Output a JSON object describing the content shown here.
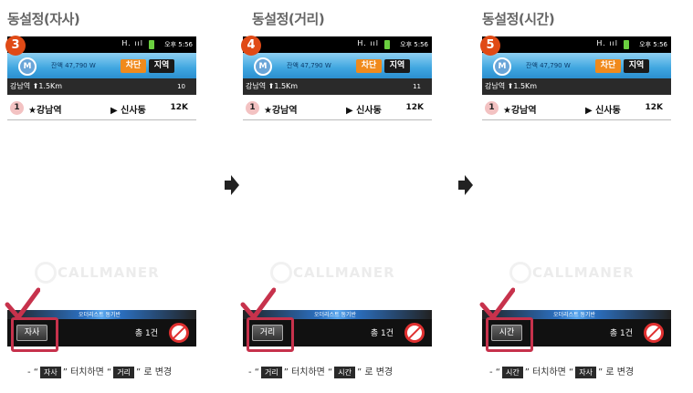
{
  "panels": [
    {
      "title": "동설정(자사)",
      "step": "3",
      "status": {
        "signal": "H. ııl",
        "time": "오후 5:56"
      },
      "header": {
        "logo": "M",
        "balance": "잔액 47,790 W",
        "block_button": "차단",
        "area_button": "지역"
      },
      "location": {
        "name": "강남역 ⬆1.5Km",
        "count": "10"
      },
      "call": {
        "number": "1",
        "from": "★강남역",
        "to": "▶ 신사동",
        "distance": "12K"
      },
      "watermark": "CALLMANER",
      "bottom": {
        "banner": "오더리스트 동기반",
        "mode_button": "자사",
        "count": "총 1건"
      },
      "caption": {
        "prefix": "- “",
        "chip1": "자사",
        "mid": "” 터치하면 “",
        "chip2": "거리",
        "suffix": "” 로 변경"
      }
    },
    {
      "title": "동설정(거리)",
      "step": "4",
      "status": {
        "signal": "H. ııl",
        "time": "오후 5:56"
      },
      "header": {
        "logo": "M",
        "balance": "잔액 47,790 W",
        "block_button": "차단",
        "area_button": "지역"
      },
      "location": {
        "name": "강남역 ⬆1.5Km",
        "count": "11"
      },
      "call": {
        "number": "1",
        "from": "★강남역",
        "to": "▶ 신사동",
        "distance": "12K"
      },
      "watermark": "CALLMANER",
      "bottom": {
        "banner": "오더리스트 동기반",
        "mode_button": "거리",
        "count": "총 1건"
      },
      "caption": {
        "prefix": "- “",
        "chip1": "거리",
        "mid": "” 터치하면 “",
        "chip2": "시간",
        "suffix": "” 로 변경"
      }
    },
    {
      "title": "동설정(시간)",
      "step": "5",
      "status": {
        "signal": "H. ııl",
        "time": "오후 5:56"
      },
      "header": {
        "logo": "M",
        "balance": "잔액 47,790 W",
        "block_button": "차단",
        "area_button": "지역"
      },
      "location": {
        "name": "강남역 ⬆1.5Km",
        "count": ""
      },
      "call": {
        "number": "1",
        "from": "★강남역",
        "to": "▶ 신사동",
        "distance": "12K"
      },
      "watermark": "CALLMANER",
      "bottom": {
        "banner": "오더리스트 동기반",
        "mode_button": "시간",
        "count": "총 1건"
      },
      "caption": {
        "prefix": "- “",
        "chip1": "시간",
        "mid": "” 터치하면 “",
        "chip2": "자사",
        "suffix": "” 로 변경"
      }
    }
  ],
  "icons": {
    "arrow": "right-arrow-icon",
    "check": "checkmark-icon",
    "no_sign": "prohibited-icon",
    "battery": "battery-icon"
  },
  "colors": {
    "step_badge": "#e04a16",
    "highlight": "#c7324c",
    "block_button": "#f08a1c",
    "header_blue": "#3fa6e0"
  }
}
